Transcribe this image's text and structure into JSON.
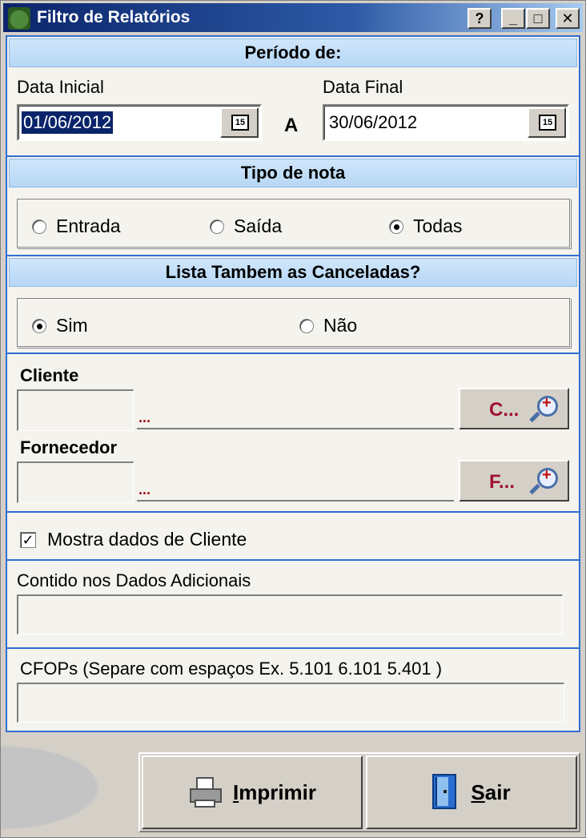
{
  "window": {
    "title": "Filtro de Relatórios",
    "buttons": {
      "help": "?",
      "minimize": "_",
      "maximize": "□",
      "close": "✕"
    }
  },
  "periodo": {
    "header": "Período de:",
    "data_inicial_label": "Data Inicial",
    "data_inicial_value": "01/06/2012",
    "separator": "A",
    "data_final_label": "Data Final",
    "data_final_value": "30/06/2012",
    "calendar_icon_text": "15"
  },
  "tipo_nota": {
    "header": "Tipo de nota",
    "options": [
      "Entrada",
      "Saída",
      "Todas"
    ],
    "selected": "Todas"
  },
  "canceladas": {
    "header": "Lista Tambem as Canceladas?",
    "options": [
      "Sim",
      "Não"
    ],
    "selected": "Sim"
  },
  "cliente": {
    "label": "Cliente",
    "code_value": "",
    "name_placeholder": "...",
    "button_label": "C..."
  },
  "fornecedor": {
    "label": "Fornecedor",
    "code_value": "",
    "name_placeholder": "...",
    "button_label": "F..."
  },
  "mostra_dados": {
    "label": "Mostra dados de Cliente",
    "checked": true
  },
  "dados_adicionais": {
    "label": "Contido nos Dados Adicionais",
    "value": ""
  },
  "cfops": {
    "label": "CFOPs (Separe com espaços Ex. 5.101 6.101 5.401 )",
    "value": ""
  },
  "footer": {
    "print_label_first": "I",
    "print_label_rest": "mprimir",
    "exit_label_first": "S",
    "exit_label_rest": "air"
  },
  "colors": {
    "accent_border": "#2f6fd4",
    "header_fill": "#cfe6fb",
    "selection": "#0a246a",
    "button_text": "#a01030"
  }
}
